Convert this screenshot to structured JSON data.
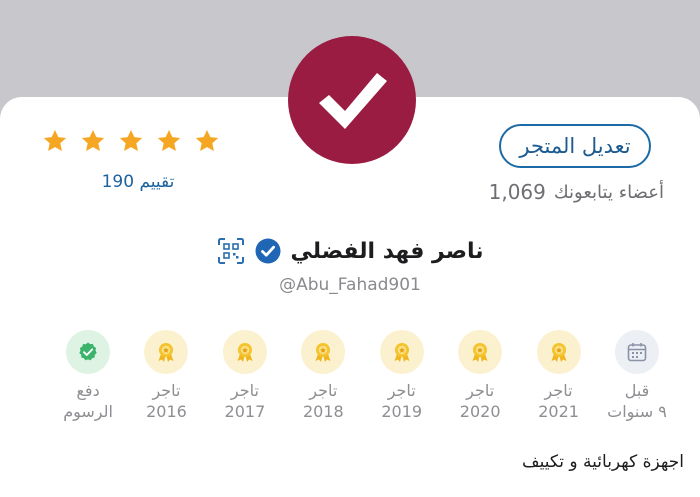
{
  "profile": {
    "name": "ناصر فهد الفضلي",
    "handle": "@Abu_Fahad901",
    "verified": true,
    "avatar_color": "#9a1c43"
  },
  "actions": {
    "edit_store_label": "تعديل المتجر"
  },
  "followers": {
    "label": "أعضاء يتابعونك",
    "count": "1,069"
  },
  "rating": {
    "stars": 5,
    "label": "تقييم 190"
  },
  "badges": [
    {
      "line1": "قبل",
      "line2": "٩ سنوات",
      "icon": "calendar-icon"
    },
    {
      "line1": "تاجر",
      "line2": "2021",
      "icon": "medal-icon"
    },
    {
      "line1": "تاجر",
      "line2": "2020",
      "icon": "medal-icon"
    },
    {
      "line1": "تاجر",
      "line2": "2019",
      "icon": "medal-icon"
    },
    {
      "line1": "تاجر",
      "line2": "2018",
      "icon": "medal-icon"
    },
    {
      "line1": "تاجر",
      "line2": "2017",
      "icon": "medal-icon"
    },
    {
      "line1": "تاجر",
      "line2": "2016",
      "icon": "medal-icon"
    },
    {
      "line1": "دفع",
      "line2": "الرسوم",
      "icon": "verified-seal-icon"
    }
  ],
  "category": "اجهزة كهربائية و تكييف",
  "colors": {
    "accent": "#1c6aa6",
    "star": "#f5a623",
    "gold_badge": "#fbf1cf",
    "green_badge": "#dff3e4"
  }
}
